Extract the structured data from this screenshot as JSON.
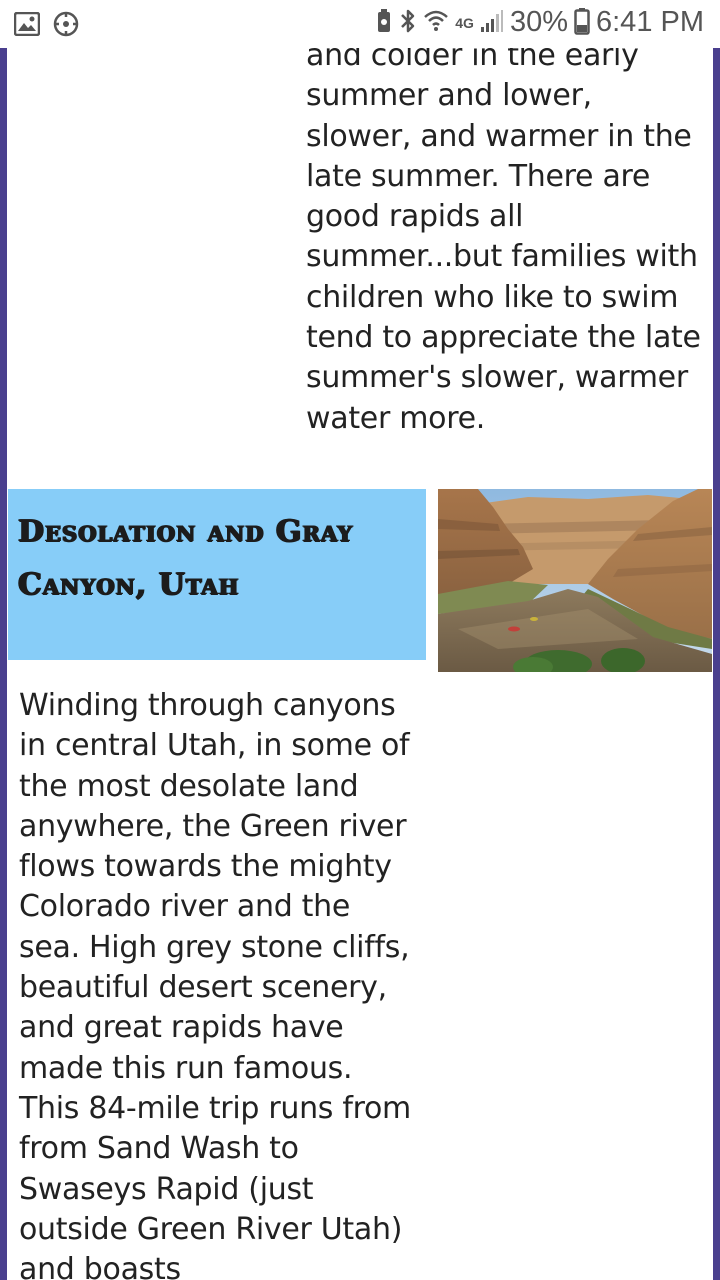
{
  "status_bar": {
    "network": "4G",
    "battery": "30%",
    "time": "6:41 PM"
  },
  "article": {
    "top_paragraph": "and colder in the early summer and lower, slower, and warmer in the late summer. There are good rapids all summer...but families with children who like to swim tend to appreciate the late summer's slower, warmer water more.",
    "section_title": "Desolation and Gray Canyon, Utah",
    "section_body": "Winding through canyons in central Utah, in some of the most desolate land anywhere, the Green river flows towards the mighty Colorado river and the sea. High grey stone cliffs, beautiful desert scenery, and great rapids have made this run famous. This 84-mile trip runs from from Sand Wash to Swaseys Rapid (just outside Green River Utah) and boasts"
  },
  "colors": {
    "frame": "#4a3f8e",
    "title_background": "#87cdf8"
  }
}
